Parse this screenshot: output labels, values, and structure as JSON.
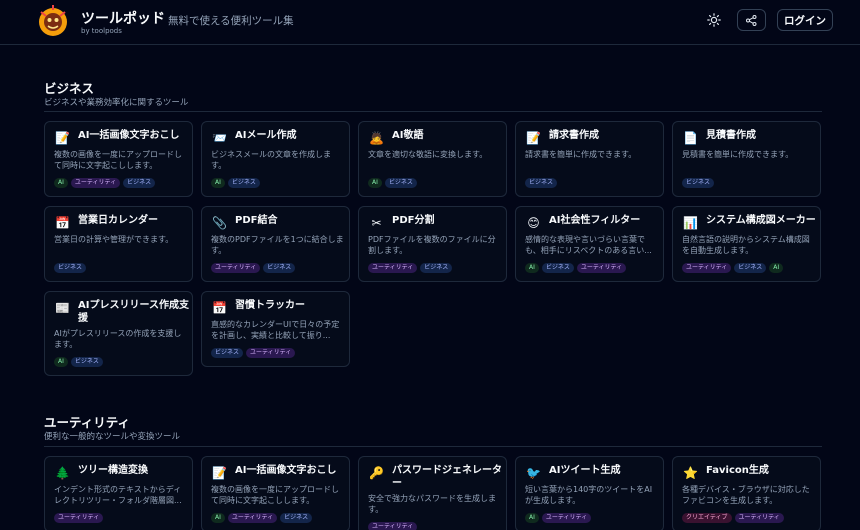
{
  "header": {
    "brand_name": "ツールポッド",
    "brand_sub": "by toolpods",
    "tagline": "無料で使える便利ツール集",
    "login_label": "ログイン"
  },
  "sections": [
    {
      "title": "ビジネス",
      "desc": "ビジネスや業務効率化に関するツール",
      "cards": [
        {
          "icon": "memo-icon",
          "glyph": "📝",
          "title": "AI一括画像文字おこし",
          "desc": "複数の画像を一度にアップロードして同時に文字起こしします。",
          "tags": [
            "AI",
            "ユーティリティ",
            "ビジネス"
          ]
        },
        {
          "icon": "envelope-icon",
          "glyph": "📨",
          "title": "AIメール作成",
          "desc": "ビジネスメールの文章を作成します。",
          "tags": [
            "AI",
            "ビジネス"
          ]
        },
        {
          "icon": "bowing-person-icon",
          "glyph": "🙇",
          "title": "AI敬語",
          "desc": "文章を適切な敬語に変換します。",
          "tags": [
            "AI",
            "ビジネス"
          ]
        },
        {
          "icon": "memo-icon",
          "glyph": "📝",
          "title": "請求書作成",
          "desc": "請求書を簡単に作成できます。",
          "tags": [
            "ビジネス"
          ]
        },
        {
          "icon": "document-icon",
          "glyph": "📄",
          "title": "見積書作成",
          "desc": "見積書を簡単に作成できます。",
          "tags": [
            "ビジネス"
          ]
        },
        {
          "icon": "calendar-icon",
          "glyph": "📅",
          "title": "営業日カレンダー",
          "desc": "営業日の計算や管理ができます。",
          "tags": [
            "ビジネス"
          ]
        },
        {
          "icon": "paperclip-icon",
          "glyph": "📎",
          "title": "PDF結合",
          "desc": "複数のPDFファイルを1つに結合します。",
          "tags": [
            "ユーティリティ",
            "ビジネス"
          ]
        },
        {
          "icon": "scissors-icon",
          "glyph": "✂",
          "title": "PDF分割",
          "desc": "PDFファイルを複数のファイルに分割します。",
          "tags": [
            "ユーティリティ",
            "ビジネス"
          ]
        },
        {
          "icon": "smiley-icon",
          "glyph": "😊",
          "title": "AI社会性フィルター",
          "desc": "感情的な表現や言いづらい言葉でも、相手にリスペクトのある言い...",
          "tags": [
            "AI",
            "ビジネス",
            "ユーティリティ"
          ]
        },
        {
          "icon": "bar-chart-icon",
          "glyph": "📊",
          "title": "システム構成図メーカー",
          "desc": "自然言語の説明からシステム構成図を自動生成します。",
          "tags": [
            "ユーティリティ",
            "ビジネス",
            "AI"
          ]
        },
        {
          "icon": "newspaper-icon",
          "glyph": "📰",
          "title": "AIプレスリリース作成支援",
          "desc": "AIがプレスリリースの作成を支援します。",
          "tags": [
            "AI",
            "ビジネス"
          ]
        },
        {
          "icon": "calendar-icon",
          "glyph": "📅",
          "title": "習慣トラッカー",
          "desc": "直感的なカレンダーUIで日々の予定を計画し、実績と比較して振り...",
          "tags": [
            "ビジネス",
            "ユーティリティ"
          ]
        }
      ]
    },
    {
      "title": "ユーティリティ",
      "desc": "便利な一般的なツールや変換ツール",
      "cards": [
        {
          "icon": "tree-icon",
          "glyph": "🌲",
          "title": "ツリー構造変換",
          "desc": "インデント形式のテキストからディレクトリツリー・フォルダ階層図...",
          "tags": [
            "ユーティリティ"
          ]
        },
        {
          "icon": "memo-icon",
          "glyph": "📝",
          "title": "AI一括画像文字おこし",
          "desc": "複数の画像を一度にアップロードして同時に文字起こしします。",
          "tags": [
            "AI",
            "ユーティリティ",
            "ビジネス"
          ]
        },
        {
          "icon": "key-icon",
          "glyph": "🔑",
          "title": "パスワードジェネレーター",
          "desc": "安全で強力なパスワードを生成します。",
          "tags": [
            "ユーティリティ"
          ]
        },
        {
          "icon": "bird-icon",
          "glyph": "🐦",
          "title": "AIツイート生成",
          "desc": "短い言葉から140字のツイートをAIが生成します。",
          "tags": [
            "AI",
            "ユーティリティ"
          ]
        },
        {
          "icon": "star-icon",
          "glyph": "⭐",
          "title": "Favicon生成",
          "desc": "各種デバイス・ブラウザに対応したファビコンを生成します。",
          "tags": [
            "クリエイティブ",
            "ユーティリティ"
          ]
        }
      ]
    }
  ],
  "tag_styles": {
    "AI": "tag-ai",
    "ユーティリティ": "tag-util",
    "ビジネス": "tag-biz",
    "クリエイティブ": "tag-creative"
  },
  "colors": {
    "background": "#020617",
    "card_border": "#1e293b",
    "muted_text": "#94a3b8"
  }
}
